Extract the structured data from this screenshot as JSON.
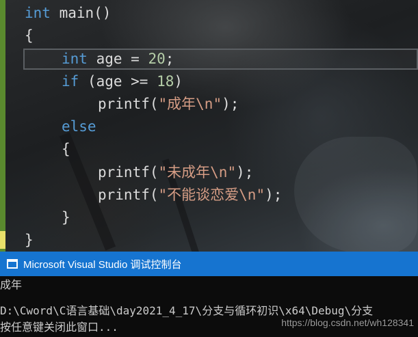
{
  "editor": {
    "lines": [
      {
        "keyword": "int",
        "rest": " main()"
      },
      {
        "text": "{"
      },
      {
        "keyword": "int",
        "mid": " age = ",
        "number": "20",
        "tail": ";"
      },
      {
        "keyword": "if",
        "mid": " (age >= ",
        "number": "18",
        "tail": ")"
      },
      {
        "pre": "printf(",
        "string": "\"成年\\n\"",
        "tail": ");"
      },
      {
        "keyword": "else"
      },
      {
        "text": "{"
      },
      {
        "pre": "printf(",
        "string": "\"未成年\\n\"",
        "tail": ");"
      },
      {
        "pre": "printf(",
        "string": "\"不能谈恋爱\\n\"",
        "tail": ");"
      },
      {
        "text": "}"
      },
      {
        "text": "}"
      }
    ],
    "colors": {
      "keyword": "#569cd6",
      "number": "#b5cea8",
      "string": "#d69d85",
      "text": "#dcdcdc"
    }
  },
  "console": {
    "title": "Microsoft Visual Studio 调试控制台",
    "output": [
      "成年",
      "",
      "D:\\Cword\\C语言基础\\day2021_4_17\\分支与循环初识\\x64\\Debug\\分支",
      "按任意键关闭此窗口..."
    ],
    "watermark": "https://blog.csdn.net/wh128341",
    "colors": {
      "titlebar": "#1674d0",
      "background": "#0c0c0c"
    }
  }
}
